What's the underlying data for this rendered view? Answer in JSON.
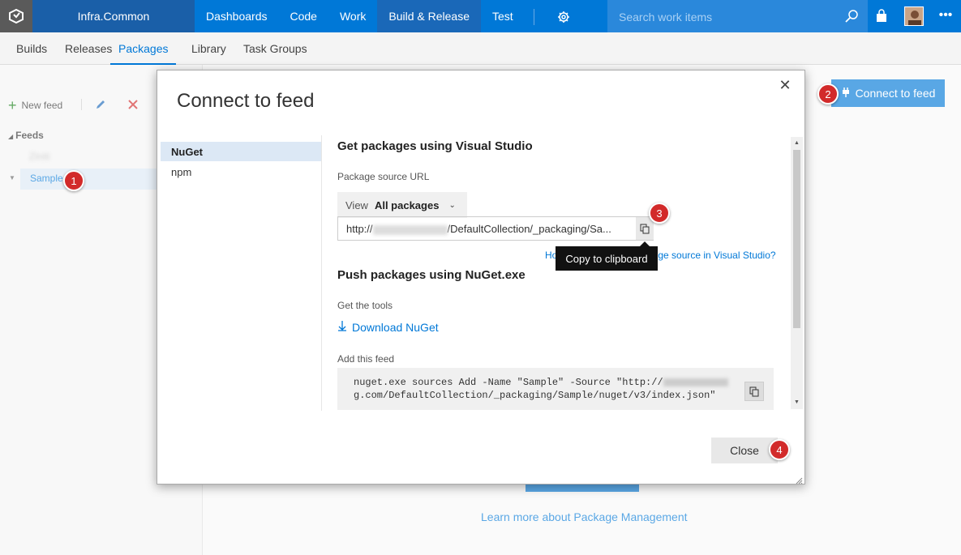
{
  "topbar": {
    "project": "Infra.Common",
    "nav": [
      "Dashboards",
      "Code",
      "Work",
      "Build & Release",
      "Test"
    ],
    "active_nav": "Build & Release",
    "search_placeholder": "Search work items"
  },
  "subnav": {
    "items": [
      "Builds",
      "Releases",
      "Packages",
      "Library",
      "Task Groups"
    ],
    "active": "Packages"
  },
  "sidebar": {
    "new_feed_label": "New feed",
    "feeds_header": "Feeds",
    "feeds": [
      "Ziniti",
      "Sample"
    ],
    "selected_feed": "Sample"
  },
  "main": {
    "connect_button": "Connect to feed",
    "learn_more": "Learn more about Package Management"
  },
  "dialog": {
    "title": "Connect to feed",
    "tabs": [
      "NuGet",
      "npm"
    ],
    "active_tab": "NuGet",
    "vs_heading": "Get packages using Visual Studio",
    "source_url_label": "Package source URL",
    "view_label": "View",
    "view_value": "All packages",
    "url_prefix": "http://",
    "url_suffix": "/DefaultCollection/_packaging/Sa...",
    "copy_tooltip": "Copy to clipboard",
    "how_link_start": "Ho",
    "how_link_end": "ge source in Visual Studio?",
    "push_heading": "Push packages using NuGet.exe",
    "get_tools_label": "Get the tools",
    "download_link": "Download NuGet",
    "add_feed_label": "Add this feed",
    "command_line1_start": "nuget.exe sources Add -Name \"Sample\" -Source \"http://",
    "command_line2": "g.com/DefaultCollection/_packaging/Sample/nuget/v3/index.json\"",
    "close_button": "Close"
  },
  "annotations": [
    "1",
    "2",
    "3",
    "4"
  ],
  "colors": {
    "accent": "#0078d7",
    "badge": "#d22a2a",
    "topbar_dark": "#1a5fa8"
  }
}
